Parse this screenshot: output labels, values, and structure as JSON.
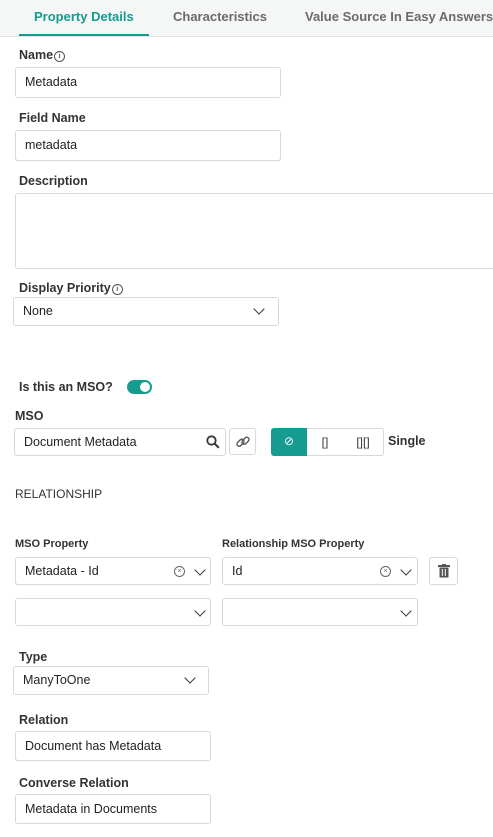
{
  "tabs": [
    {
      "label": "Property Details",
      "active": true
    },
    {
      "label": "Characteristics",
      "active": false
    },
    {
      "label": "Value Source In Easy Answers",
      "active": false
    }
  ],
  "name": {
    "label": "Name",
    "value": "Metadata"
  },
  "field_name": {
    "label": "Field Name",
    "value": "metadata"
  },
  "description": {
    "label": "Description",
    "value": ""
  },
  "display_priority": {
    "label": "Display Priority",
    "value": "None"
  },
  "is_mso": {
    "label": "Is this an MSO?",
    "on": true
  },
  "mso": {
    "label": "MSO",
    "value": "Document Metadata"
  },
  "cardinality": {
    "options": [
      "⊘",
      "[]",
      "[][]"
    ],
    "selected_index": 0,
    "label": "Single"
  },
  "relationship": {
    "heading": "RELATIONSHIP",
    "mso_property_label": "MSO Property",
    "relationship_mso_property_label": "Relationship MSO Property",
    "rows": [
      {
        "mso_property": "Metadata - Id",
        "relationship_mso_property": "Id"
      },
      {
        "mso_property": "",
        "relationship_mso_property": ""
      }
    ]
  },
  "type": {
    "label": "Type",
    "value": "ManyToOne"
  },
  "relation": {
    "label": "Relation",
    "value": "Document has Metadata"
  },
  "converse_relation": {
    "label": "Converse Relation",
    "value": "Metadata in Documents"
  },
  "colors": {
    "accent": "#159b8f"
  }
}
